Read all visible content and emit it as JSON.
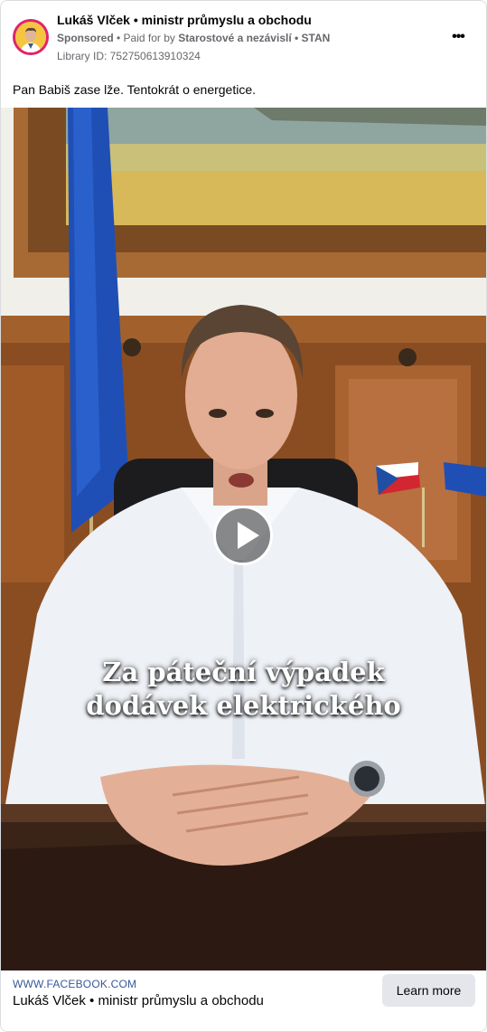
{
  "post": {
    "page_name": "Lukáš Vlček • ministr průmyslu a obchodu",
    "sponsored_label": "Sponsored",
    "separator": " • ",
    "paid_for_prefix": "Paid for by",
    "payer": "Starostové a nezávislí • STAN",
    "library_id": "Library ID: 752750613910324",
    "more_icon_label": "•••",
    "caption": "Pan Babiš zase lže. Tentokrát o energetice."
  },
  "video": {
    "overlay_line1": "Za páteční výpadek",
    "overlay_line2": "dodávek elektrického",
    "play_icon": "play-icon"
  },
  "footer": {
    "domain": "WWW.FACEBOOK.COM",
    "title": "Lukáš Vlček • ministr průmyslu a obchodu",
    "cta_label": "Learn more"
  },
  "colors": {
    "link_blue": "#385898",
    "meta_gray": "#65676b",
    "button_gray": "#e4e6eb",
    "avatar_ring": "#e0226e"
  }
}
